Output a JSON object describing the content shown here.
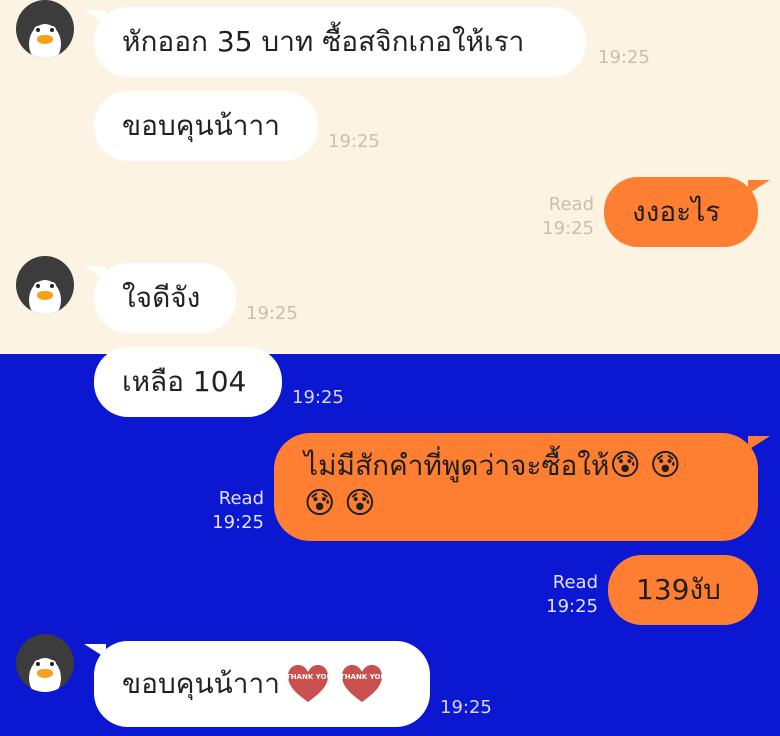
{
  "colors": {
    "top_bg": "#fcf3e3",
    "bottom_bg": "#0b17d1",
    "outgoing": "#fe7e32",
    "incoming": "#ffffff"
  },
  "messages": [
    {
      "side": "in",
      "text": "หักออก 35 บาท ซื้อสจิกเกอให้เรา",
      "time": "19:25"
    },
    {
      "side": "in",
      "text": "ขอบคุนน้าาา",
      "time": "19:25"
    },
    {
      "side": "out",
      "text": "งงอะไร",
      "read": "Read",
      "time": "19:25"
    },
    {
      "side": "in",
      "text": "ใจดีจัง",
      "time": "19:25"
    },
    {
      "side": "in",
      "text": "เหลือ 104",
      "time": "19:25"
    },
    {
      "side": "out",
      "text": "ไม่มีสักคำที่พูดว่าจะซื้อให้",
      "emoji": [
        "😰",
        "😰",
        "😰",
        "😰"
      ],
      "read": "Read",
      "time": "19:25"
    },
    {
      "side": "out",
      "text": "139งับ",
      "read": "Read",
      "time": "19:25"
    },
    {
      "side": "in",
      "text": "ขอบคุนน้าาา",
      "sticker_text": "THANK YOU",
      "sticker_icon": "thank-you-heart-icon",
      "time": "19:25"
    }
  ]
}
